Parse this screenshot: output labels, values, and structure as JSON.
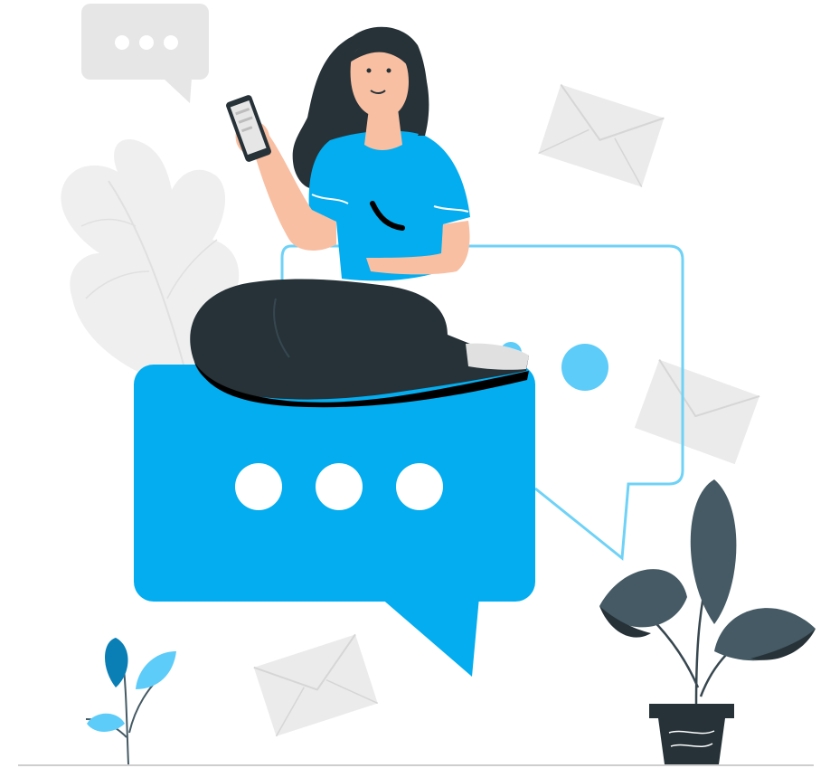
{
  "illustration": {
    "subject": "woman-sitting-on-chat-bubble-with-phone",
    "icons": [
      "speech-bubble-icon",
      "envelope-icon",
      "leaf-icon",
      "plant-icon",
      "smartphone-icon"
    ]
  },
  "colors": {
    "primary_blue": "#03ADEF",
    "light_blue_dot": "#5DCCF9",
    "outline_blue": "#6FD2F7",
    "gray_shape": "#E6E6E6",
    "leaf_gray": "#EFEFEF",
    "dark_pants": "#263238",
    "black": "#000000",
    "skin": "#F8BFA2",
    "hair": "#263238",
    "plant_dark": "#37474F",
    "plant_mid": "#455A64",
    "small_plant_dark": "#0A7FB5",
    "small_plant_light": "#5DCCF9",
    "ground_line": "#BDBDBD",
    "white": "#FFFFFF"
  }
}
